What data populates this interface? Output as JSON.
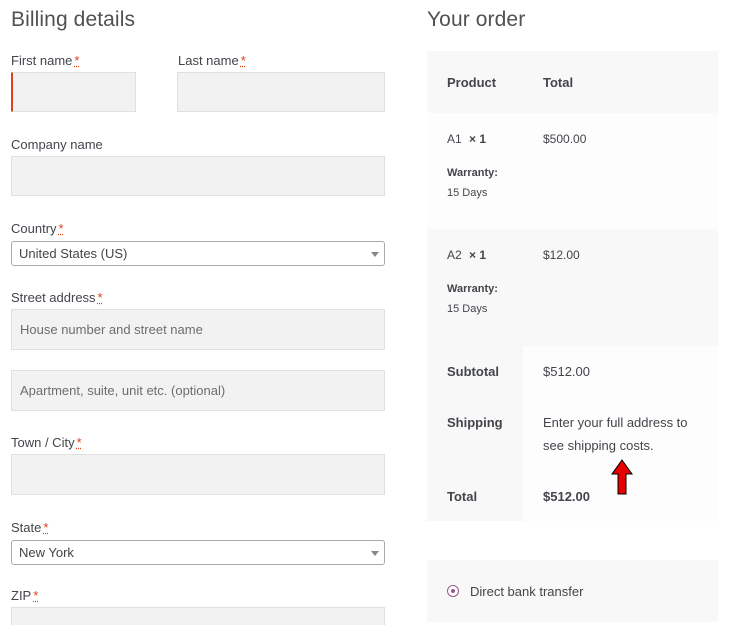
{
  "billing": {
    "heading": "Billing details",
    "required_mark": "*",
    "first_name_label": "First name",
    "last_name_label": "Last name",
    "company_label": "Company name",
    "country_label": "Country",
    "country_value": "United States (US)",
    "street_label": "Street address",
    "street_placeholder": "House number and street name",
    "apartment_placeholder": "Apartment, suite, unit etc. (optional)",
    "city_label": "Town / City",
    "state_label": "State",
    "state_value": "New York",
    "zip_label": "ZIP"
  },
  "order": {
    "heading": "Your order",
    "col_product": "Product",
    "col_total": "Total",
    "items": [
      {
        "name": "A1",
        "qty": "× 1",
        "price": "$500.00",
        "meta_label": "Warranty:",
        "meta_value": "15 Days"
      },
      {
        "name": "A2",
        "qty": "× 1",
        "price": "$12.00",
        "meta_label": "Warranty:",
        "meta_value": "15 Days"
      }
    ],
    "subtotal_label": "Subtotal",
    "subtotal_value": "$512.00",
    "shipping_label": "Shipping",
    "shipping_line1": "Enter your full address to",
    "shipping_line2": "see shipping costs.",
    "total_label": "Total",
    "total_value": "$512.00"
  },
  "payment": {
    "method_label": "Direct bank transfer"
  },
  "colors": {
    "required": "#e2401c",
    "arrow": "#e60000",
    "radio": "#96588a"
  }
}
